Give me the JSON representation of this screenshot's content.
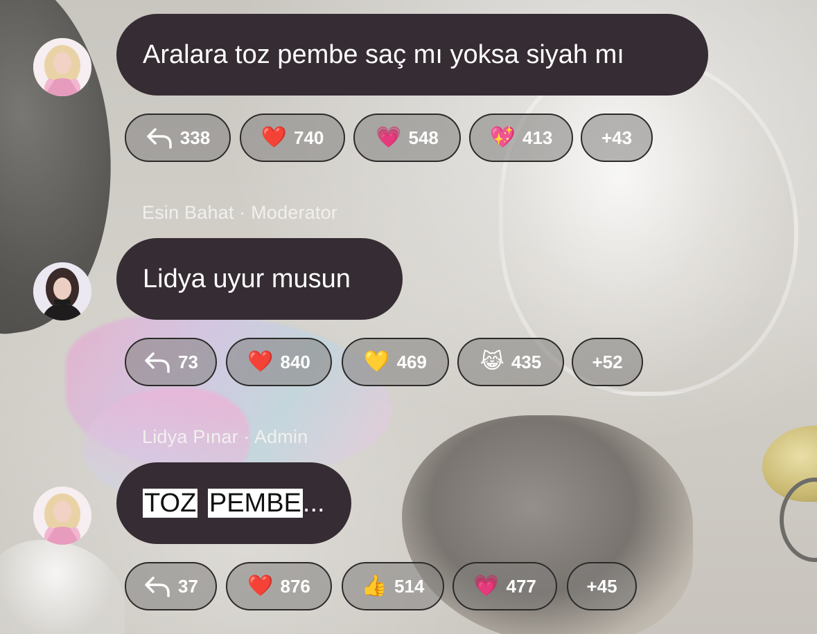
{
  "messages": [
    {
      "sender": "",
      "avatar_icon": "avatar-blonde-woman",
      "text": "Aralara toz pembe saç mı yoksa siyah mı",
      "reactions": {
        "reply_count": "338",
        "items": [
          {
            "emoji": "❤️",
            "icon": "red-heart-icon",
            "count": "740"
          },
          {
            "emoji": "💗",
            "icon": "pink-heart-icon",
            "count": "548"
          },
          {
            "emoji": "💖",
            "icon": "sparkling-heart-icon",
            "count": "413"
          }
        ],
        "more": "+43"
      }
    },
    {
      "sender": "Esin Bahat · Moderator",
      "avatar_icon": "avatar-dark-hair-woman",
      "text": "Lidya uyur musun",
      "reactions": {
        "reply_count": "73",
        "items": [
          {
            "emoji": "❤️",
            "icon": "red-heart-icon",
            "count": "840"
          },
          {
            "emoji": "💛",
            "icon": "yellow-heart-icon",
            "count": "469"
          },
          {
            "emoji": "😹",
            "icon": "cat-tears-of-joy-icon",
            "count": "435"
          }
        ],
        "more": "+52"
      }
    },
    {
      "sender": "Lidya Pınar · Admin",
      "avatar_icon": "avatar-blonde-woman",
      "text_parts": [
        "TOZ",
        "PEMBE",
        "..."
      ],
      "reactions": {
        "reply_count": "37",
        "items": [
          {
            "emoji": "❤️",
            "icon": "red-heart-icon",
            "count": "876"
          },
          {
            "emoji": "👍",
            "icon": "thumbs-up-icon",
            "count": "514"
          },
          {
            "emoji": "💗",
            "icon": "pink-heart-icon",
            "count": "477"
          }
        ],
        "more": "+45"
      }
    }
  ],
  "colors": {
    "bubble": "#362c33",
    "chip_border": "#2b2a29",
    "highlight": "#ffffff"
  }
}
